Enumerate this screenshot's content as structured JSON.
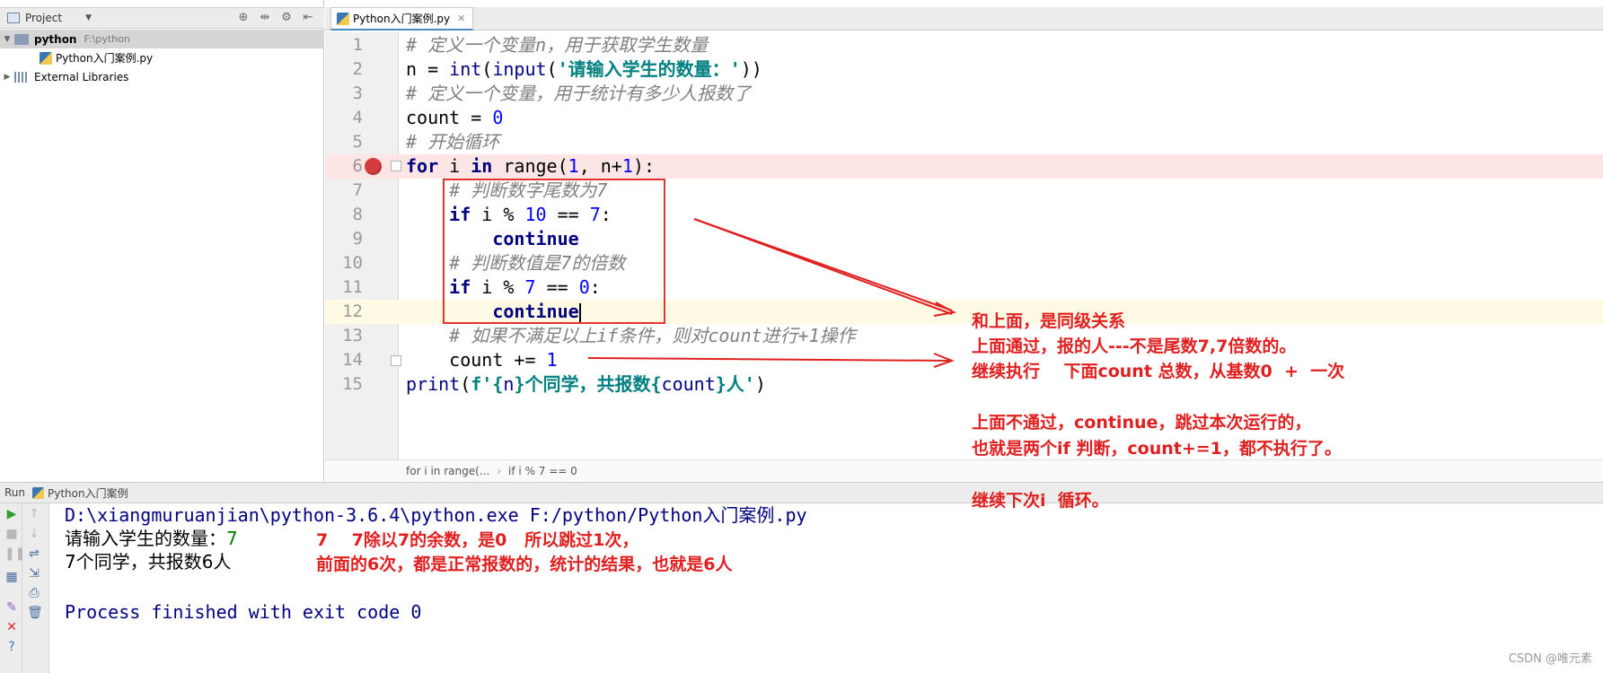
{
  "project_panel": {
    "title": "Project",
    "root": {
      "name": "python",
      "path": "F:\\python"
    },
    "file": "Python入门案例.py",
    "external": "External Libraries"
  },
  "editor": {
    "tab": "Python入门案例.py",
    "lines": [
      "1",
      "2",
      "3",
      "4",
      "5",
      "6",
      "7",
      "8",
      "9",
      "10",
      "11",
      "12",
      "13",
      "14",
      "15"
    ],
    "code": {
      "l1": "# 定义一个变量n，用于获取学生数量",
      "l2_a": "n = ",
      "l2_int": "int",
      "l2_b": "(",
      "l2_input": "input",
      "l2_c": "(",
      "l2_str": "'请输入学生的数量：'",
      "l2_d": "))",
      "l3": "# 定义一个变量，用于统计有多少人报数了",
      "l4_a": "count = ",
      "l4_n": "0",
      "l5": "# 开始循环",
      "l6_for": "for",
      "l6_a": " i ",
      "l6_in": "in",
      "l6_b": " range(",
      "l6_n1": "1",
      "l6_c": ", n+",
      "l6_n2": "1",
      "l6_d": "):",
      "l7": "    # 判断数字尾数为7",
      "l8_ind": "    ",
      "l8_if": "if",
      "l8_a": " i % ",
      "l8_n1": "10",
      "l8_b": " == ",
      "l8_n2": "7",
      "l8_c": ":",
      "l9_ind": "        ",
      "l9_kw": "continue",
      "l10": "    # 判断数值是7的倍数",
      "l11_ind": "    ",
      "l11_if": "if",
      "l11_a": " i % ",
      "l11_n1": "7",
      "l11_b": " == ",
      "l11_n2": "0",
      "l11_c": ":",
      "l12_ind": "        ",
      "l12_kw": "continue",
      "l13": "    # 如果不满足以上if条件，则对count进行+1操作",
      "l14_a": "    count += ",
      "l14_n": "1",
      "l15_print": "print",
      "l15_a": "(",
      "l15_s1": "f'{",
      "l15_v1": "n",
      "l15_s2": "}个同学，共报数{",
      "l15_v2": "count",
      "l15_s3": "}人'",
      "l15_b": ")"
    },
    "breadcrumb": [
      "for i in range(...",
      "if i % 7 == 0"
    ]
  },
  "run": {
    "title": "Run",
    "config": "Python入门案例",
    "console": {
      "cmd": "D:\\xiangmuruanjian\\python-3.6.4\\python.exe F:/python/Python入门案例.py",
      "prompt": "请输入学生的数量：",
      "input_value": "7",
      "result": "7个同学，共报数6人",
      "exit": "Process finished with exit code 0"
    }
  },
  "annotations": {
    "note1": "和上面，是同级关系",
    "note2": "上面通过，报的人---不是尾数7,7倍数的。",
    "note3": "继续执行    下面count 总数，从基数0  +  一次",
    "note4": "上面不通过，continue，跳过本次运行的，",
    "note5": "也就是两个if 判断，count+=1，都不执行了。",
    "note6": "继续下次i  循环。",
    "note7": "7    7除以7的余数，是0   所以跳过1次，",
    "note8": "前面的6次，都是正常报数的，统计的结果，也就是6人",
    "color": "#e02020"
  },
  "watermark": "CSDN @唯元素"
}
